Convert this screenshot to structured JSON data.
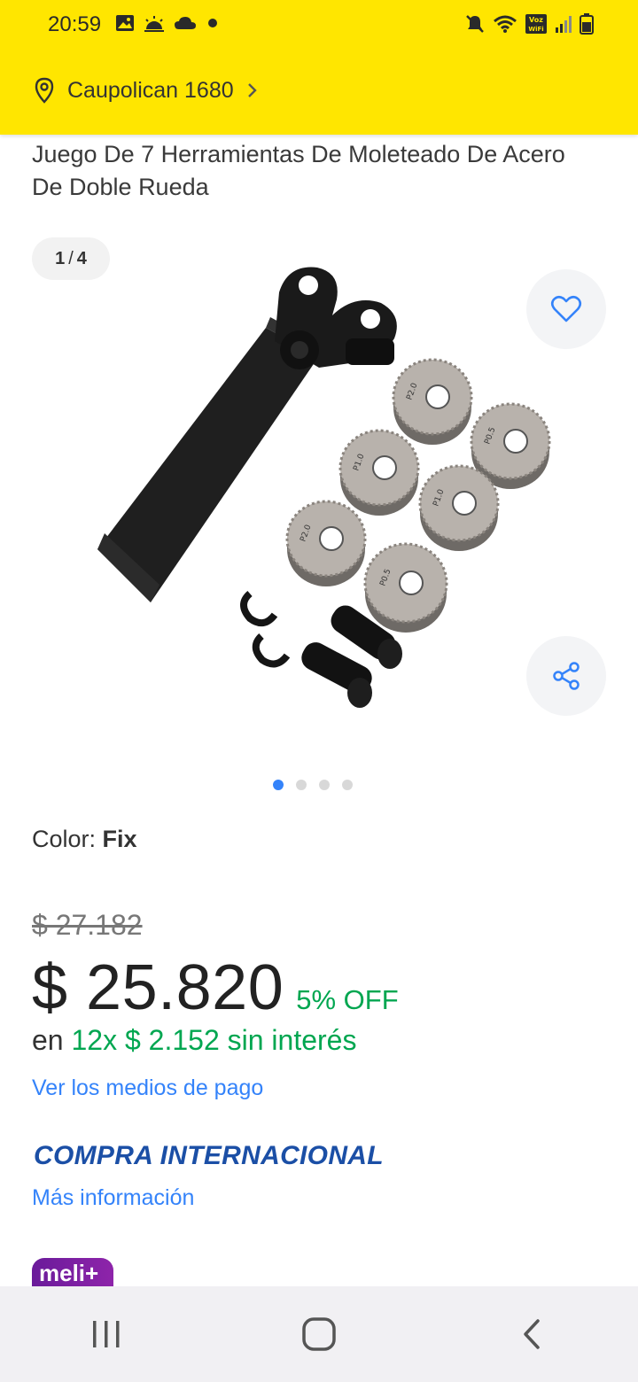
{
  "status_bar": {
    "time": "20:59",
    "left_icons": [
      "image-icon",
      "weather-sun-icon",
      "cloud-icon",
      "notification-dot-icon"
    ],
    "right_icons": [
      "mute-icon",
      "wifi-icon",
      "volte-icon",
      "signal-icon",
      "battery-icon"
    ],
    "voz_label": "Voz",
    "wifi_label": "WiFi"
  },
  "header": {
    "location": "Caupolican 1680",
    "bg_color": "#FFE600"
  },
  "product": {
    "title": "Juego De 7 Herramientas De Moleteado De Acero De Doble Rueda",
    "gallery": {
      "current": "1",
      "separator": "/",
      "total": "4",
      "dots": 4,
      "active_dot": 0
    },
    "color_label": "Color:",
    "color_value": "Fix",
    "old_price": "$ 27.182",
    "price": "$ 25.820",
    "discount": "5% OFF",
    "installments_prefix": "en",
    "installments_highlight": "12x $ 2.152 sin interés",
    "payment_link": "Ver los medios de pago",
    "international_label": "COMPRA INTERNACIONAL",
    "more_info_link": "Más información",
    "meli_badge": "meli+"
  },
  "roller_labels": [
    "P2.0",
    "P0.5",
    "P1.0",
    "P1.0",
    "P2.0",
    "P0.5"
  ],
  "navbar": {
    "buttons": [
      "recents-icon",
      "home-icon",
      "back-icon"
    ]
  },
  "colors": {
    "accent_blue": "#3483FA",
    "green": "#00A650",
    "intl_blue": "#1B4FA6"
  }
}
